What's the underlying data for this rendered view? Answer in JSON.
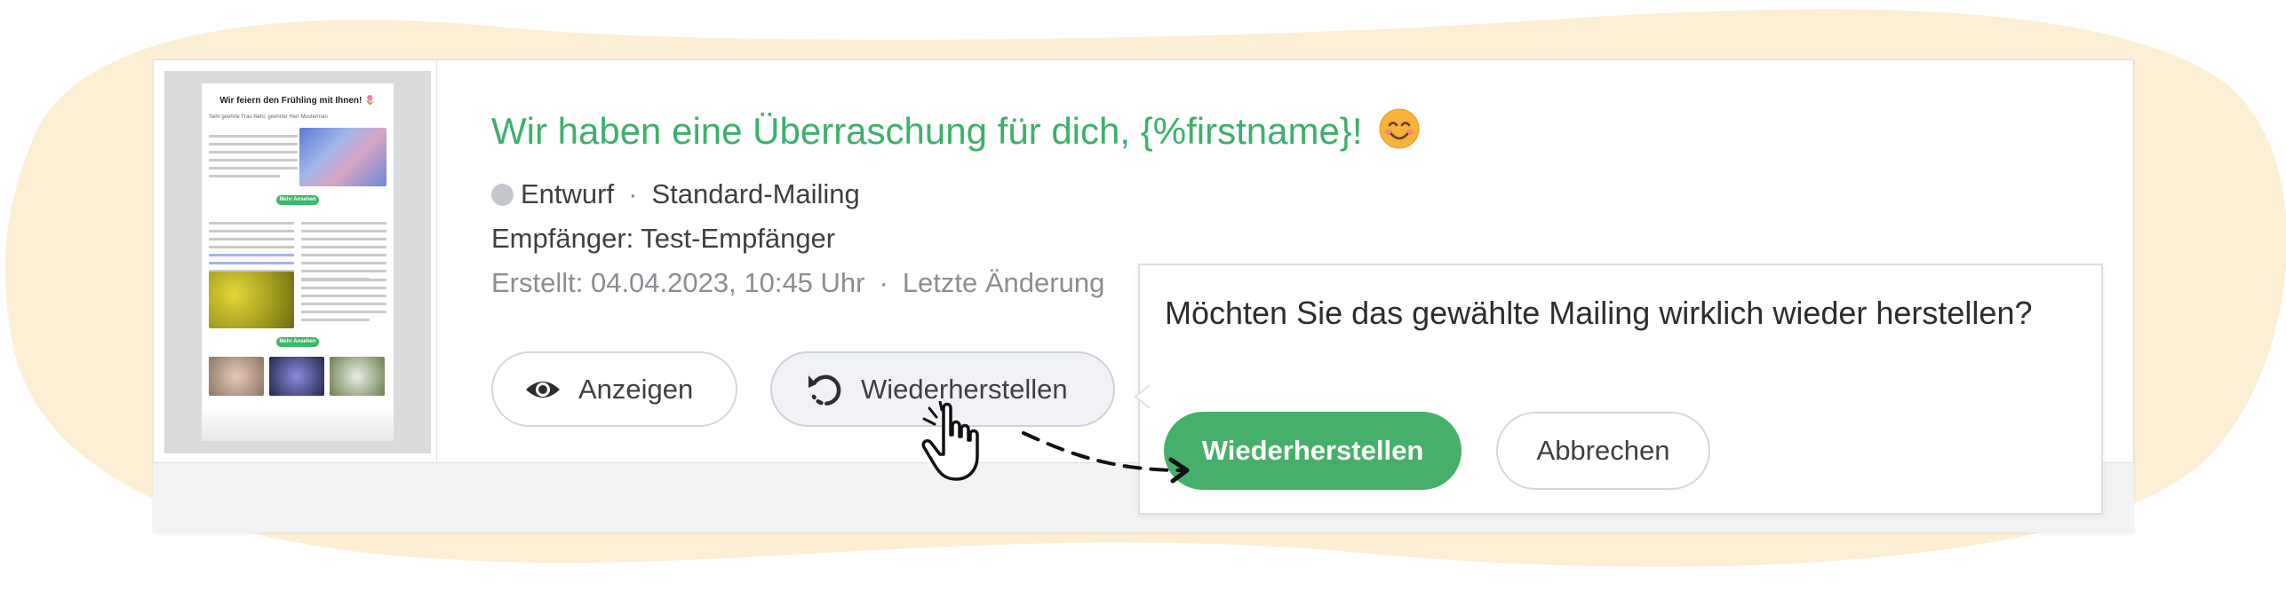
{
  "mailing": {
    "title": "Wir haben eine Überraschung für dich, {%firstname}!",
    "emoji": "smiling-face-emoji",
    "status": "Entwurf",
    "separator": "·",
    "type": "Standard-Mailing",
    "recipients": "Empfänger: Test-Empfänger",
    "created": "Erstellt: 04.04.2023, 10:45 Uhr",
    "modified_prefix": "Letzte Änderung"
  },
  "thumbnail": {
    "heading": "Wir feiern den Frühling mit Ihnen! 🌷",
    "subheading": "Sehr geehrte Frau Nehr, geehrter Herr Musterman",
    "button_label": "Mehr Ansehen"
  },
  "actions": {
    "view_label": "Anzeigen",
    "restore_label": "Wiederherstellen"
  },
  "confirm": {
    "question": "Möchten Sie das gewählte Mailing wirklich wieder herstellen?",
    "confirm_label": "Wiederherstellen",
    "cancel_label": "Abbrechen"
  },
  "colors": {
    "accent_green": "#3bb16a",
    "button_green": "#46b06b",
    "background_blob": "#fcefd3",
    "status_dot": "#c4c8ce"
  },
  "icons": [
    "eye-icon",
    "restore-icon",
    "hand-pointer-icon",
    "dashed-arrow-icon"
  ]
}
